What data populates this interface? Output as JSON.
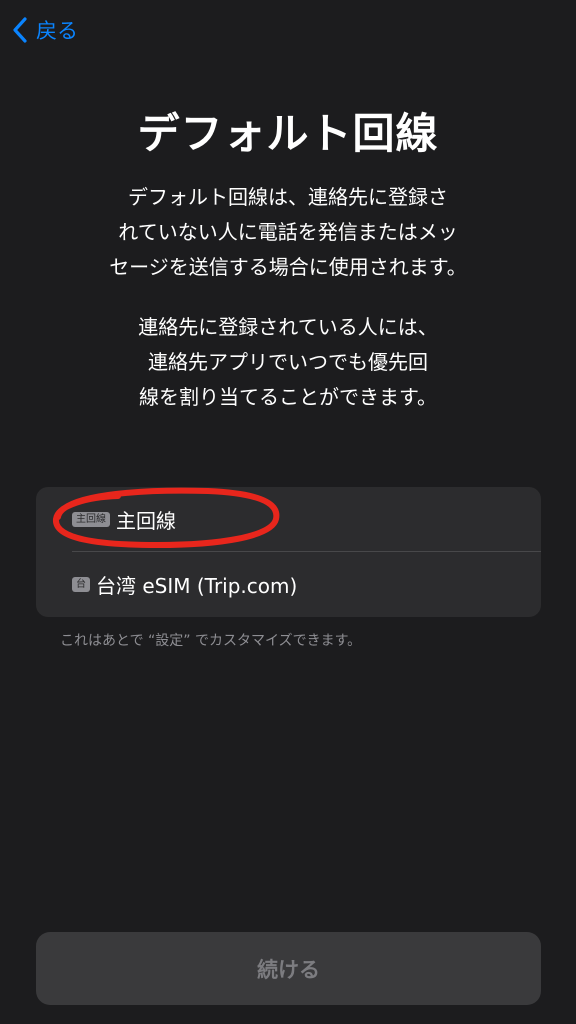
{
  "nav": {
    "back_label": "戻る"
  },
  "title": "デフォルト回線",
  "description": {
    "para1": [
      "デフォルト回線は、連絡先に登録さ",
      "れていない人に電話を発信またはメッ",
      "セージを送信する場合に使用されます。"
    ],
    "para2": [
      "連絡先に登録されている人には、",
      "連絡先アプリでいつでも優先回",
      "線を割り当てることができます。"
    ]
  },
  "lines": [
    {
      "badge": "主回線",
      "label": "主回線",
      "icon": "sim-badge-icon"
    },
    {
      "badge": "台",
      "label": "台湾 eSIM (Trip.com)",
      "icon": "sim-badge-icon"
    }
  ],
  "footnote": "これはあとで “設定” でカスタマイズできます。",
  "continue_button": {
    "label": "続ける",
    "enabled": false
  },
  "colors": {
    "background": "#1c1c1e",
    "accent": "#0a84ff",
    "annotation": "#e8261c"
  }
}
